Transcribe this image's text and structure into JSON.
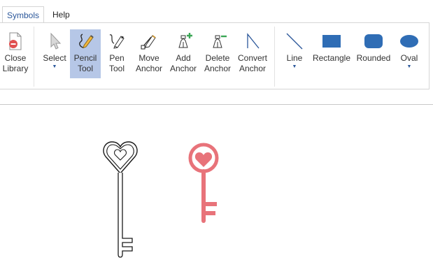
{
  "tabs": {
    "symbols": "Symbols",
    "help": "Help"
  },
  "ribbon": {
    "close_library": [
      "Close",
      "Library"
    ],
    "select": "Select",
    "pencil_tool": [
      "Pencil",
      "Tool"
    ],
    "pen_tool": [
      "Pen",
      "Tool"
    ],
    "move_anchor": [
      "Move",
      "Anchor"
    ],
    "add_anchor": [
      "Add",
      "Anchor"
    ],
    "delete_anchor": [
      "Delete",
      "Anchor"
    ],
    "convert_anchor": [
      "Convert",
      "Anchor"
    ],
    "line": "Line",
    "rectangle": "Rectangle",
    "rounded": "Rounded",
    "oval": "Oval"
  },
  "colors": {
    "accent": "#2b579a",
    "shape_fill": "#2f6db5",
    "active_bg": "#b6c7e7",
    "key_red": "#e8737a",
    "key_outline": "#1a1a1a"
  }
}
